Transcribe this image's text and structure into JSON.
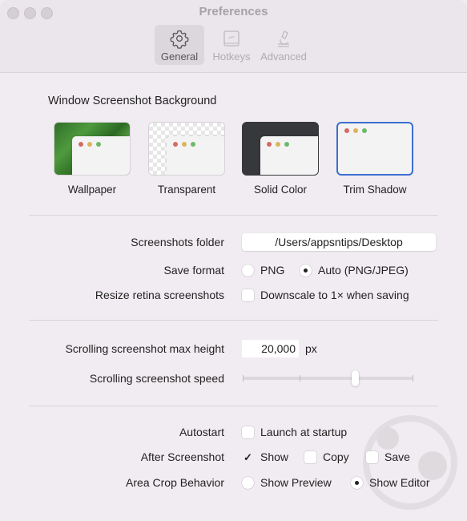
{
  "window": {
    "title": "Preferences"
  },
  "toolbar": {
    "tabs": [
      {
        "label": "General",
        "icon": "gear-icon",
        "active": true
      },
      {
        "label": "Hotkeys",
        "icon": "keyboard-icon",
        "active": false
      },
      {
        "label": "Advanced",
        "icon": "microscope-icon",
        "active": false
      }
    ]
  },
  "background": {
    "title": "Window Screenshot Background",
    "options": [
      {
        "label": "Wallpaper",
        "selected": false
      },
      {
        "label": "Transparent",
        "selected": false
      },
      {
        "label": "Solid Color",
        "selected": false
      },
      {
        "label": "Trim Shadow",
        "selected": true
      }
    ],
    "selected_color": "#3a6fcf"
  },
  "general": {
    "folder_label": "Screenshots folder",
    "folder_value": "/Users/appsntips/Desktop",
    "format_label": "Save format",
    "format_options": [
      {
        "label": "PNG",
        "selected": false
      },
      {
        "label": "Auto (PNG/JPEG)",
        "selected": true
      }
    ],
    "retina_label": "Resize retina screenshots",
    "retina_option": {
      "label": "Downscale to 1× when saving",
      "checked": false
    }
  },
  "scrolling": {
    "max_height_label": "Scrolling screenshot max height",
    "max_height_value": "20,000",
    "max_height_unit": "px",
    "speed_label": "Scrolling screenshot speed",
    "speed_ticks": 4,
    "speed_value_fraction": 0.66
  },
  "behavior": {
    "autostart_label": "Autostart",
    "autostart_option": {
      "label": "Launch at startup",
      "checked": false
    },
    "after_label": "After Screenshot",
    "after_options": [
      {
        "label": "Show",
        "checked": true
      },
      {
        "label": "Copy",
        "checked": false
      },
      {
        "label": "Save",
        "checked": false
      }
    ],
    "crop_label": "Area Crop Behavior",
    "crop_options": [
      {
        "label": "Show Preview",
        "selected": false
      },
      {
        "label": "Show Editor",
        "selected": true
      }
    ]
  }
}
